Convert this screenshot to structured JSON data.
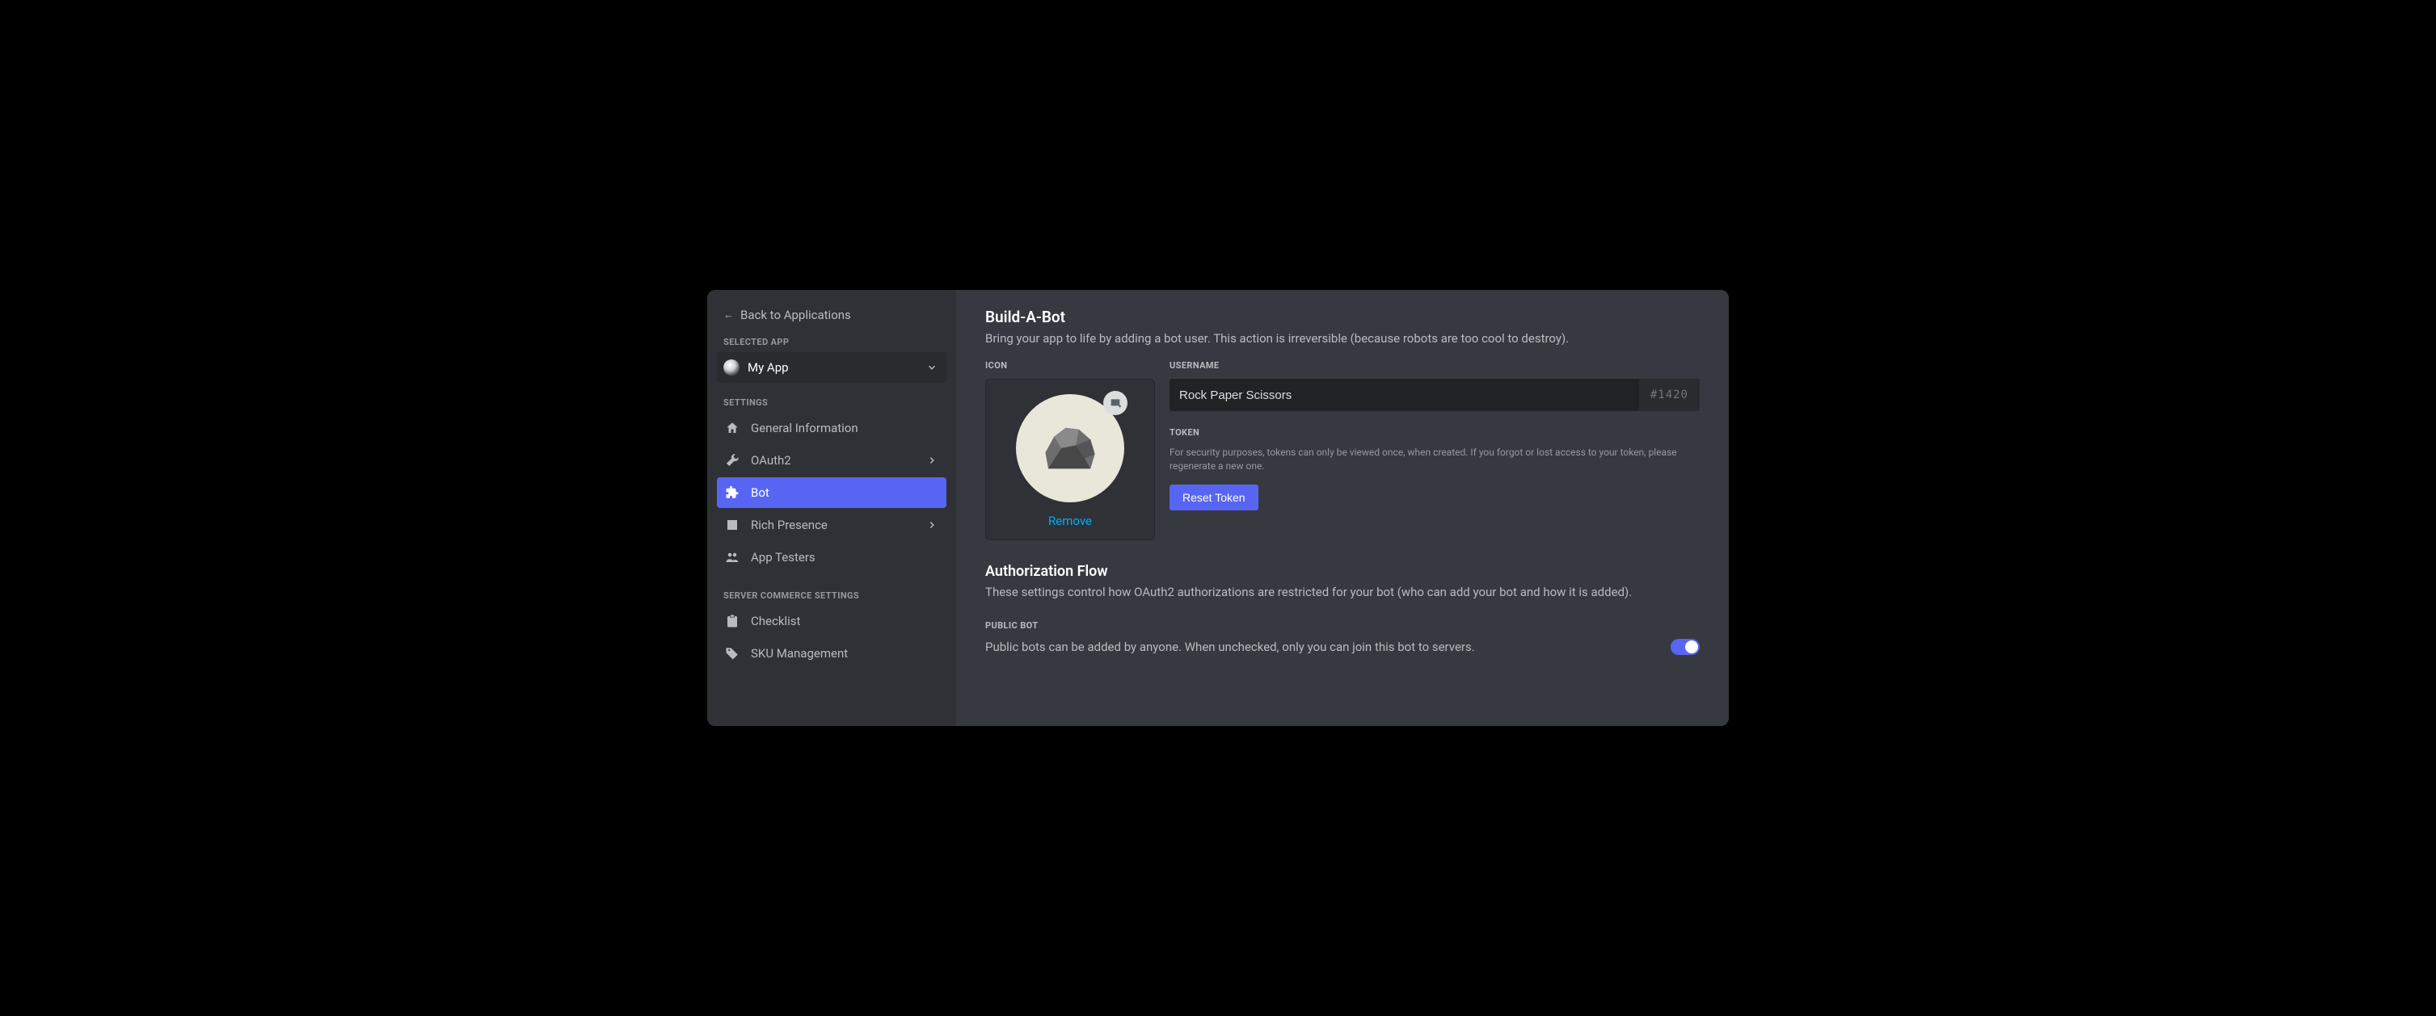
{
  "back_link": "Back to Applications",
  "selected_app_header": "Selected App",
  "selected_app_name": "My App",
  "settings_header": "Settings",
  "nav": {
    "general": "General Information",
    "oauth2": "OAuth2",
    "bot": "Bot",
    "rich_presence": "Rich Presence",
    "app_testers": "App Testers"
  },
  "server_commerce_header": "Server Commerce Settings",
  "commerce_nav": {
    "checklist": "Checklist",
    "sku": "SKU Management"
  },
  "page": {
    "title": "Build-A-Bot",
    "subtitle": "Bring your app to life by adding a bot user. This action is irreversible (because robots are too cool to destroy).",
    "icon_label": "Icon",
    "remove": "Remove",
    "username_label": "Username",
    "username_value": "Rock Paper Scissors",
    "discriminator": "#1420",
    "token_label": "Token",
    "token_help": "For security purposes, tokens can only be viewed once, when created. If you forgot or lost access to your token, please regenerate a new one.",
    "reset_token": "Reset Token",
    "auth_flow_title": "Authorization Flow",
    "auth_flow_sub": "These settings control how OAuth2 authorizations are restricted for your bot (who can add your bot and how it is added).",
    "public_bot_label": "Public Bot",
    "public_bot_desc": "Public bots can be added by anyone. When unchecked, only you can join this bot to servers."
  }
}
